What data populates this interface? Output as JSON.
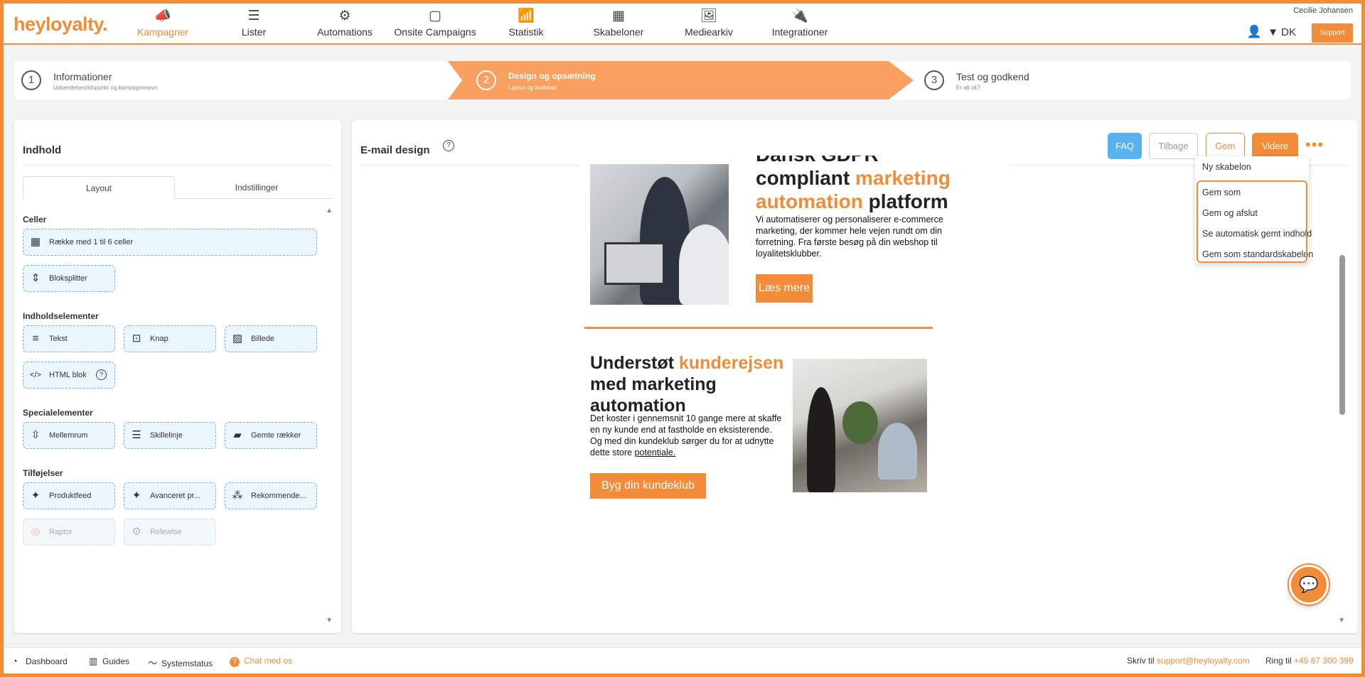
{
  "app": {
    "logo": "heyloyalty."
  },
  "nav": {
    "items": [
      {
        "label": "Kampagner",
        "icon": "megaphone-icon",
        "glyph": "📣"
      },
      {
        "label": "Lister",
        "icon": "list-icon",
        "glyph": "☰"
      },
      {
        "label": "Automations",
        "icon": "gears-icon",
        "glyph": "⚙"
      },
      {
        "label": "Onsite Campaigns",
        "icon": "window-icon",
        "glyph": "▢"
      },
      {
        "label": "Statistik",
        "icon": "bar-chart-icon",
        "glyph": "📶"
      },
      {
        "label": "Skabeloner",
        "icon": "calculator-icon",
        "glyph": "▦"
      },
      {
        "label": "Mediearkiv",
        "icon": "image-icon",
        "glyph": "🖼"
      },
      {
        "label": "Integrationer",
        "icon": "plug-icon",
        "glyph": "🔌"
      }
    ],
    "user_name": "Cecilie Johansen",
    "lang": "▼ DK",
    "support_label": "Support"
  },
  "stepper": {
    "steps": [
      {
        "num": "1",
        "title": "Informationer",
        "sub": "Udsendelsestidspunkt og kampagnenavn"
      },
      {
        "num": "2",
        "title": "Design og opsætning",
        "sub": "Layout og budskab"
      },
      {
        "num": "3",
        "title": "Test og godkend",
        "sub": "Er alt ok?"
      }
    ]
  },
  "left": {
    "title": "Indhold",
    "tabs": [
      "Layout",
      "Indstillinger"
    ],
    "sections": {
      "celler": "Celler",
      "indholdselementer": "Indholdselementer",
      "specialelementer": "Specialelementer",
      "tilfoejelser": "Tilføjelser"
    },
    "blocks": {
      "raekke": "Række med 1 til 6 celler",
      "bloksplitter": "Bloksplitter",
      "tekst": "Tekst",
      "knap": "Knap",
      "billede": "Billede",
      "html": "HTML blok",
      "mellemrum": "Mellemrum",
      "skillelinje": "Skillelinje",
      "gemte": "Gemte rækker",
      "produktfeed": "Produktfeed",
      "avanceret": "Avanceret pr...",
      "rekommende": "Rekommende...",
      "raptor": "Raptor",
      "relewise": "Relewise"
    }
  },
  "right": {
    "title": "E-mail design",
    "buttons": {
      "faq": "FAQ",
      "tilbage": "Tilbage",
      "gem": "Gem",
      "videre": "Videre",
      "more": "•••"
    },
    "dropdown": [
      "Ny skabelon",
      "Gem som",
      "Gem og afslut",
      "Se automatisk gemt indhold",
      "Gem som standardskabelon"
    ]
  },
  "email": {
    "h1_a": "Dansk GDPR",
    "h1_b": "compliant ",
    "h1_c": "marketing automation",
    "h1_d": " platform",
    "p1": "Vi automatiserer og personaliserer e-commerce marketing, der kommer hele vejen rundt om din forretning. Fra første besøg på din webshop til loyalitetsklubber.",
    "cta1": "Læs mere",
    "h2_a": "Understøt ",
    "h2_b": "kunderejsen",
    "h2_c": " med marketing automation",
    "p2_a": "Det koster i gennemsnit 10 gange mere at skaffe en ny kunde end at fastholde en eksisterende. Og med din kundeklub sørger du for at udnytte dette store ",
    "p2_b": "potentiale.",
    "cta2": "Byg din kundeklub"
  },
  "footer": {
    "dashboard": "Dashboard",
    "guides": "Guides",
    "systemstatus": "Systemstatus",
    "chat": "Chat med os",
    "skriv_til": "Skriv til",
    "email": "support@heyloyalty.com",
    "ring_til": "Ring til",
    "phone": "+45 87 300 399"
  },
  "colors": {
    "accent": "#f28c38",
    "faq": "#5ab1f0",
    "step_active": "#f9a060"
  }
}
